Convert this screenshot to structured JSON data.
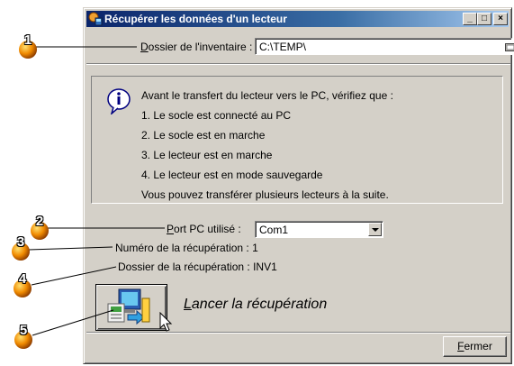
{
  "window": {
    "title": "Récupérer les données d'un lecteur",
    "minimize_label": "_",
    "maximize_label": "□",
    "close_label": "×"
  },
  "inventory": {
    "label_underlined": "D",
    "label_rest": "ossier de l'inventaire :",
    "value": "C:\\TEMP\\"
  },
  "info": {
    "intro": "Avant le transfert du lecteur vers le PC, vérifiez que :",
    "items": [
      "1. Le socle est connecté au PC",
      "2. Le socle est en marche",
      "3. Le lecteur est en marche",
      "4. Le lecteur est en mode sauvegarde"
    ],
    "footer": "Vous pouvez transférer plusieurs lecteurs à la suite."
  },
  "port": {
    "label_underlined": "P",
    "label_rest": "ort PC utilisé :",
    "selected": "Com1"
  },
  "recovery": {
    "number_text": "Numéro de la récupération : 1",
    "folder_text": "Dossier de la récupération : INV1"
  },
  "launch": {
    "label_underlined": "L",
    "label_rest": "ancer la récupération"
  },
  "close_button": {
    "label_underlined": "F",
    "label_rest": "ermer"
  },
  "callouts": [
    "1",
    "2",
    "3",
    "4",
    "5"
  ],
  "colors": {
    "titlebar_start": "#0a246a",
    "titlebar_end": "#a6caf0",
    "window_face": "#d4d0c8",
    "callout_orange": "#f07c00"
  },
  "icons": {
    "app": "barcode-reader-icon",
    "info": "info-icon",
    "folder": "folder-browse-icon",
    "launch": "pc-transfer-icon",
    "cursor": "mouse-cursor-icon"
  }
}
